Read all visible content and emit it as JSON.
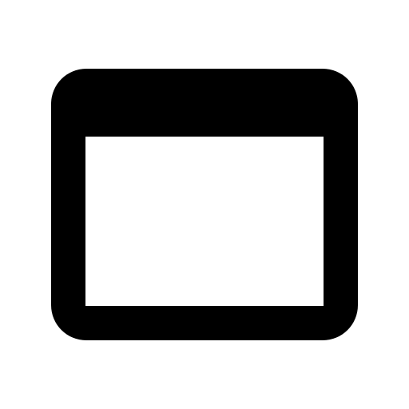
{
  "icon": {
    "name": "browser-window-icon",
    "color": "#000000",
    "background": "#ffffff"
  }
}
